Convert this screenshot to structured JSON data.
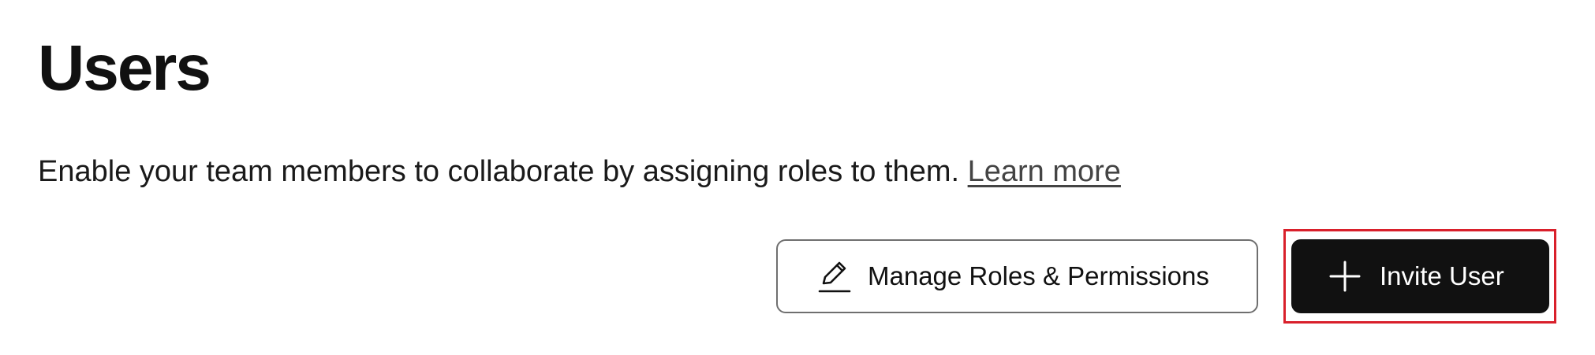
{
  "header": {
    "title": "Users"
  },
  "intro": {
    "text": "Enable your team members to collaborate by assigning roles to them.",
    "link_text": "Learn more"
  },
  "actions": {
    "manage_roles": {
      "label": "Manage Roles & Permissions",
      "icon": "pencil-icon"
    },
    "invite_user": {
      "label": "Invite User",
      "icon": "plus-icon"
    }
  },
  "colors": {
    "primary_button_bg": "#111111",
    "primary_button_text": "#ffffff",
    "highlight": "#d9202b",
    "link": "#444444"
  }
}
